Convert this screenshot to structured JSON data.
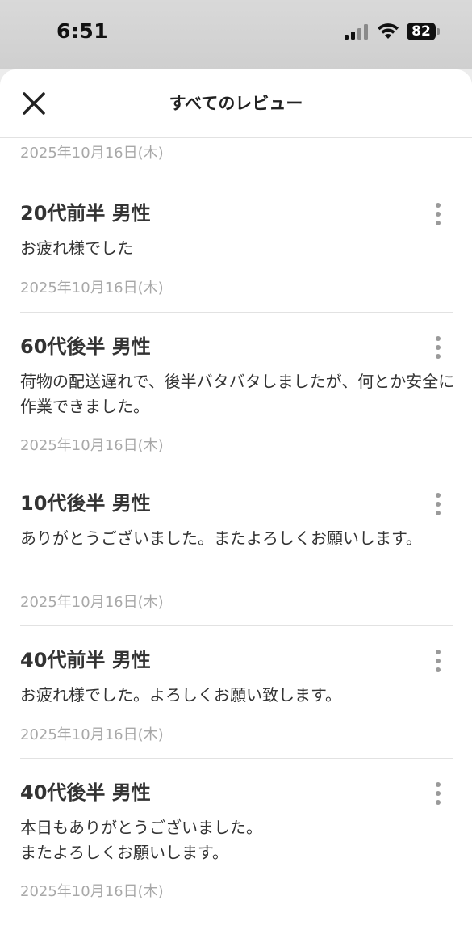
{
  "status_bar": {
    "time": "6:51",
    "battery": "82",
    "icons": [
      "cellular-signal-icon",
      "wifi-icon",
      "battery-icon"
    ]
  },
  "header": {
    "title": "すべてのレビュー",
    "close_icon": "close-icon"
  },
  "first_date": "2025年10月16日(木)",
  "reviews": [
    {
      "title": "20代前半 男性",
      "body": "お疲れ様でした",
      "date": "2025年10月16日(木)"
    },
    {
      "title": "60代後半 男性",
      "body": "荷物の配送遅れで、後半バタバタしましたが、何とか安全に作業できました。",
      "date": "2025年10月16日(木)"
    },
    {
      "title": "10代後半 男性",
      "body": "ありがとうございました。またよろしくお願いします。",
      "date": "2025年10月16日(木)"
    },
    {
      "title": "40代前半 男性",
      "body": "お疲れ様でした。よろしくお願い致します。",
      "date": "2025年10月16日(木)"
    },
    {
      "title": "40代後半 男性",
      "body": "本日もありがとうございました。\nまたよろしくお願いします。",
      "date": "2025年10月16日(木)"
    }
  ]
}
